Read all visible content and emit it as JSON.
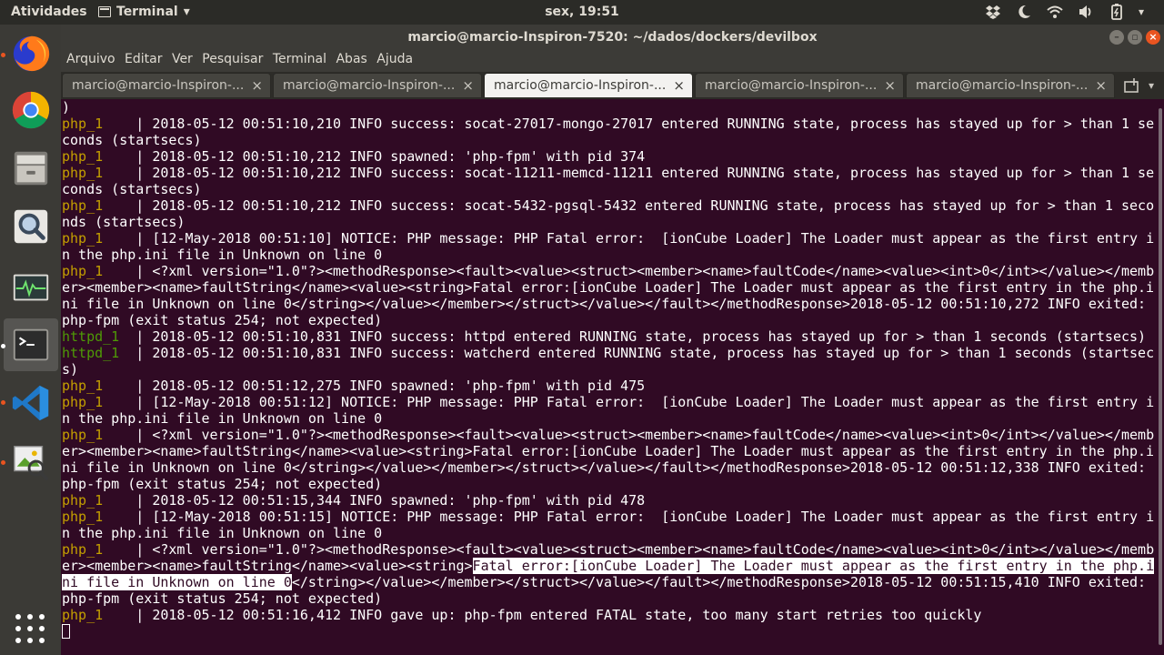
{
  "top_panel": {
    "activities": "Atividades",
    "app_menu": "Terminal",
    "clock": "sex, 19:51"
  },
  "launcher": {
    "items": [
      {
        "name": "firefox-icon"
      },
      {
        "name": "chrome-icon"
      },
      {
        "name": "files-icon"
      },
      {
        "name": "search-app-icon"
      },
      {
        "name": "system-monitor-icon"
      },
      {
        "name": "terminal-icon"
      },
      {
        "name": "vscode-icon"
      },
      {
        "name": "image-viewer-icon"
      }
    ]
  },
  "window": {
    "title": "marcio@marcio-Inspiron-7520: ~/dados/dockers/devilbox",
    "menu": [
      "Arquivo",
      "Editar",
      "Ver",
      "Pesquisar",
      "Terminal",
      "Abas",
      "Ajuda"
    ],
    "tabs": [
      {
        "label": "marcio@marcio-Inspiron-...",
        "active": false
      },
      {
        "label": "marcio@marcio-Inspiron-...",
        "active": false
      },
      {
        "label": "marcio@marcio-Inspiron-...",
        "active": true
      },
      {
        "label": "marcio@marcio-Inspiron-...",
        "active": false
      },
      {
        "label": "marcio@marcio-Inspiron-...",
        "active": false
      }
    ],
    "tab_close": "×",
    "tab_menu": "▾"
  },
  "terminal": {
    "lines": [
      {
        "segs": [
          {
            "t": ")"
          }
        ]
      },
      {
        "segs": [
          {
            "t": "php_1",
            "c": "svc"
          },
          {
            "t": "    | 2018-05-12 00:51:10,210 INFO success: socat-27017-mongo-27017 entered RUNNING state, process has stayed up for > than 1 se"
          }
        ]
      },
      {
        "segs": [
          {
            "t": "conds (startsecs)"
          }
        ]
      },
      {
        "segs": [
          {
            "t": "php_1",
            "c": "svc"
          },
          {
            "t": "    | 2018-05-12 00:51:10,212 INFO spawned: 'php-fpm' with pid 374"
          }
        ]
      },
      {
        "segs": [
          {
            "t": "php_1",
            "c": "svc"
          },
          {
            "t": "    | 2018-05-12 00:51:10,212 INFO success: socat-11211-memcd-11211 entered RUNNING state, process has stayed up for > than 1 se"
          }
        ]
      },
      {
        "segs": [
          {
            "t": "conds (startsecs)"
          }
        ]
      },
      {
        "segs": [
          {
            "t": "php_1",
            "c": "svc"
          },
          {
            "t": "    | 2018-05-12 00:51:10,212 INFO success: socat-5432-pgsql-5432 entered RUNNING state, process has stayed up for > than 1 seco"
          }
        ]
      },
      {
        "segs": [
          {
            "t": "nds (startsecs)"
          }
        ]
      },
      {
        "segs": [
          {
            "t": "php_1",
            "c": "svc"
          },
          {
            "t": "    | [12-May-2018 00:51:10] NOTICE: PHP message: PHP Fatal error:  [ionCube Loader] The Loader must appear as the first entry i"
          }
        ]
      },
      {
        "segs": [
          {
            "t": "n the php.ini file in Unknown on line 0"
          }
        ]
      },
      {
        "segs": [
          {
            "t": "php_1",
            "c": "svc"
          },
          {
            "t": "    | <?xml version=\"1.0\"?><methodResponse><fault><value><struct><member><name>faultCode</name><value><int>0</int></value></memb"
          }
        ]
      },
      {
        "segs": [
          {
            "t": "er><member><name>faultString</name><value><string>Fatal error:[ionCube Loader] The Loader must appear as the first entry in the php.i"
          }
        ]
      },
      {
        "segs": [
          {
            "t": "ni file in Unknown on line 0</string></value></member></struct></value></fault></methodResponse>2018-05-12 00:51:10,272 INFO exited:"
          }
        ]
      },
      {
        "segs": [
          {
            "t": "php-fpm (exit status 254; not expected)"
          }
        ]
      },
      {
        "segs": [
          {
            "t": "httpd_1",
            "c": "svc green"
          },
          {
            "t": "  | 2018-05-12 00:51:10,831 INFO success: httpd entered RUNNING state, process has stayed up for > than 1 seconds (startsecs)"
          }
        ]
      },
      {
        "segs": [
          {
            "t": "httpd_1",
            "c": "svc green"
          },
          {
            "t": "  | 2018-05-12 00:51:10,831 INFO success: watcherd entered RUNNING state, process has stayed up for > than 1 seconds (startsec"
          }
        ]
      },
      {
        "segs": [
          {
            "t": "s)"
          }
        ]
      },
      {
        "segs": [
          {
            "t": "php_1",
            "c": "svc"
          },
          {
            "t": "    | 2018-05-12 00:51:12,275 INFO spawned: 'php-fpm' with pid 475"
          }
        ]
      },
      {
        "segs": [
          {
            "t": "php_1",
            "c": "svc"
          },
          {
            "t": "    | [12-May-2018 00:51:12] NOTICE: PHP message: PHP Fatal error:  [ionCube Loader] The Loader must appear as the first entry i"
          }
        ]
      },
      {
        "segs": [
          {
            "t": "n the php.ini file in Unknown on line 0"
          }
        ]
      },
      {
        "segs": [
          {
            "t": "php_1",
            "c": "svc"
          },
          {
            "t": "    | <?xml version=\"1.0\"?><methodResponse><fault><value><struct><member><name>faultCode</name><value><int>0</int></value></memb"
          }
        ]
      },
      {
        "segs": [
          {
            "t": "er><member><name>faultString</name><value><string>Fatal error:[ionCube Loader] The Loader must appear as the first entry in the php.i"
          }
        ]
      },
      {
        "segs": [
          {
            "t": "ni file in Unknown on line 0</string></value></member></struct></value></fault></methodResponse>2018-05-12 00:51:12,338 INFO exited:"
          }
        ]
      },
      {
        "segs": [
          {
            "t": "php-fpm (exit status 254; not expected)"
          }
        ]
      },
      {
        "segs": [
          {
            "t": "php_1",
            "c": "svc"
          },
          {
            "t": "    | 2018-05-12 00:51:15,344 INFO spawned: 'php-fpm' with pid 478"
          }
        ]
      },
      {
        "segs": [
          {
            "t": "php_1",
            "c": "svc"
          },
          {
            "t": "    | [12-May-2018 00:51:15] NOTICE: PHP message: PHP Fatal error:  [ionCube Loader] The Loader must appear as the first entry i"
          }
        ]
      },
      {
        "segs": [
          {
            "t": "n the php.ini file in Unknown on line 0"
          }
        ]
      },
      {
        "segs": [
          {
            "t": "php_1",
            "c": "svc"
          },
          {
            "t": "    | <?xml version=\"1.0\"?><methodResponse><fault><value><struct><member><name>faultCode</name><value><int>0</int></value></memb"
          }
        ]
      },
      {
        "segs": [
          {
            "t": "er><member><name>faultString</name><value><string>"
          },
          {
            "t": "Fatal error:[ionCube Loader] The Loader must appear as the first entry in the php.i",
            "c": "sel"
          }
        ]
      },
      {
        "segs": [
          {
            "t": "ni file in Unknown on line 0",
            "c": "sel"
          },
          {
            "t": "</string></value></member></struct></value></fault></methodResponse>2018-05-12 00:51:15,410 INFO exited:"
          }
        ]
      },
      {
        "segs": [
          {
            "t": "php-fpm (exit status 254; not expected)"
          }
        ]
      },
      {
        "segs": [
          {
            "t": "php_1",
            "c": "svc"
          },
          {
            "t": "    | 2018-05-12 00:51:16,412 INFO gave up: php-fpm entered FATAL state, too many start retries too quickly"
          }
        ]
      }
    ]
  },
  "colors": {
    "terminal_bg": "#300a24",
    "service_php": "#c4a000",
    "service_httpd": "#4e9a06",
    "accent": "#e95420"
  }
}
